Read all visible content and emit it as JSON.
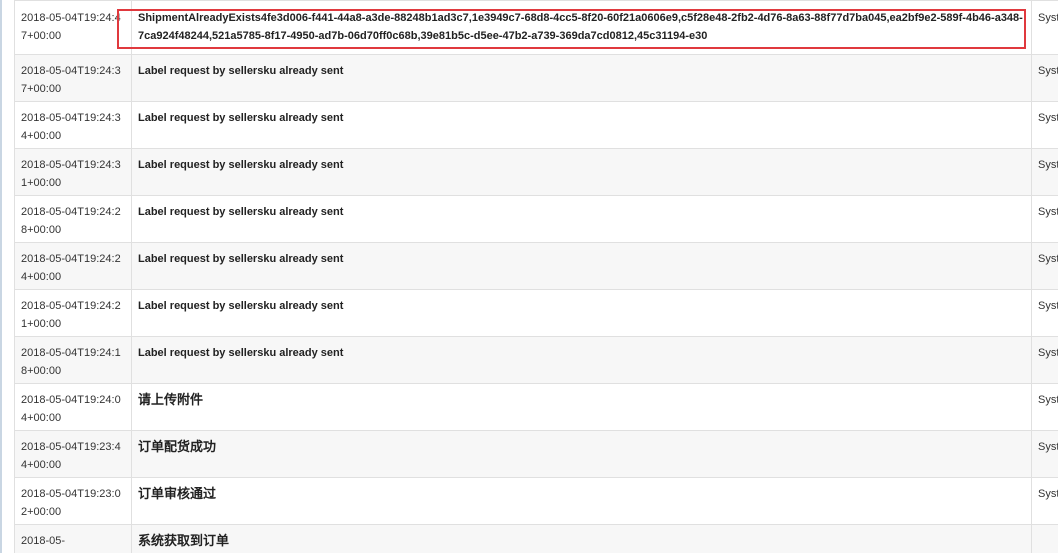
{
  "log": {
    "rows": [
      {
        "time": "2018-05-04T19:24:47+00:00",
        "message": "ShipmentAlreadyExists4fe3d006-f441-44a8-a3de-88248b1ad3c7,1e3949c7-68d8-4cc5-8f20-60f21a0606e9,c5f28e48-2fb2-4d76-8a63-88f77d7ba045,ea2bf9e2-589f-4b46-a348-7ca924f48244,521a5785-8f17-4950-ad7b-06d70ff0c68b,39e81b5c-d5ee-47b2-a739-369da7cd0812,45c31194-e30",
        "operator": "Syste"
      },
      {
        "time": "2018-05-04T19:24:37+00:00",
        "message": "Label request by sellersku already sent",
        "operator": "Syste"
      },
      {
        "time": "2018-05-04T19:24:34+00:00",
        "message": "Label request by sellersku already sent",
        "operator": "Syste"
      },
      {
        "time": "2018-05-04T19:24:31+00:00",
        "message": "Label request by sellersku already sent",
        "operator": "Syste"
      },
      {
        "time": "2018-05-04T19:24:28+00:00",
        "message": "Label request by sellersku already sent",
        "operator": "Syste"
      },
      {
        "time": "2018-05-04T19:24:24+00:00",
        "message": "Label request by sellersku already sent",
        "operator": "Syste"
      },
      {
        "time": "2018-05-04T19:24:21+00:00",
        "message": "Label request by sellersku already sent",
        "operator": "Syste"
      },
      {
        "time": "2018-05-04T19:24:18+00:00",
        "message": "Label request by sellersku already sent",
        "operator": "Syste"
      },
      {
        "time": "2018-05-04T19:24:04+00:00",
        "message": "请上传附件",
        "operator": "Syste"
      },
      {
        "time": "2018-05-04T19:23:44+00:00",
        "message": "订单配货成功",
        "operator": "Syste"
      },
      {
        "time": "2018-05-04T19:23:02+00:00",
        "message": "订单审核通过",
        "operator": "Syste"
      },
      {
        "time": "2018-05-",
        "message": "系统获取到订单",
        "operator": ""
      }
    ]
  },
  "colors": {
    "highlight_border": "#e0393e",
    "row_alt": "#f7f7f7",
    "cell_border": "#e0e0e0"
  }
}
